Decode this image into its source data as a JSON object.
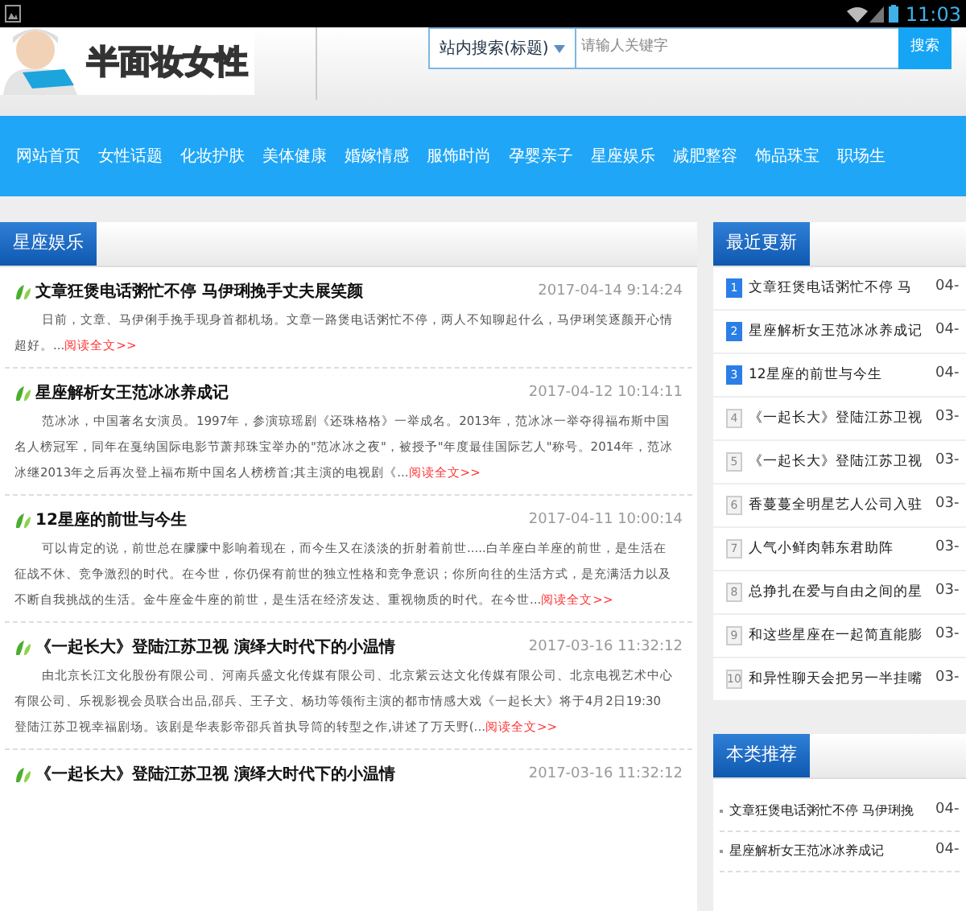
{
  "status_bar": {
    "time": "11:03"
  },
  "header": {
    "logo_text": "半面妆女性",
    "search": {
      "scope": "站内搜索(标题)",
      "placeholder": "请输人关键字",
      "button": "搜索"
    }
  },
  "nav": [
    "网站首页",
    "女性话题",
    "化妆护肤",
    "美体健康",
    "婚嫁情感",
    "服饰时尚",
    "孕婴亲子",
    "星座娱乐",
    "减肥整容",
    "饰品珠宝",
    "职场生"
  ],
  "main": {
    "tab": "星座娱乐",
    "articles": [
      {
        "title": "文章狂煲电话粥忙不停 马伊琍挽手丈夫展笑颜",
        "date": "2017-04-14 9:14:24",
        "summary": "日前，文章、马伊俐手挽手现身首都机场。文章一路煲电话粥忙不停，两人不知聊起什么，马伊琍笑逐颜开心情超好。...",
        "more": "阅读全文>>"
      },
      {
        "title": "星座解析女王范冰冰养成记",
        "date": "2017-04-12 10:14:11",
        "summary": "范冰冰，中国著名女演员。1997年，参演琼瑶剧《还珠格格》一举成名。2013年，范冰冰一举夺得福布斯中国名人榜冠军，同年在戛纳国际电影节萧邦珠宝举办的\"范冰冰之夜\"，被授予\"年度最佳国际艺人\"称号。2014年，范冰冰继2013年之后再次登上福布斯中国名人榜榜首;其主演的电视剧《...",
        "more": "阅读全文>>"
      },
      {
        "title": "12星座的前世与今生",
        "date": "2017-04-11 10:00:14",
        "summary": "可以肯定的说，前世总在朦朦中影响着现在，而今生又在淡淡的折射着前世.....白羊座白羊座的前世，是生活在征战不休、竞争激烈的时代。在今世，你仍保有前世的独立性格和竞争意识；你所向往的生活方式，是充满活力以及不断自我挑战的生活。金牛座金牛座的前世，是生活在经济发达、重视物质的时代。在今世...",
        "more": "阅读全文>>"
      },
      {
        "title": "《一起长大》登陆江苏卫视 演绎大时代下的小温情",
        "date": "2017-03-16 11:32:12",
        "summary": "由北京长江文化股份有限公司、河南兵盛文化传媒有限公司、北京紫云达文化传媒有限公司、北京电视艺术中心有限公司、乐视影视会员联合出品,邵兵、王子文、杨玏等领衔主演的都市情感大戏《一起长大》将于4月2日19:30登陆江苏卫视幸福剧场。该剧是华表影帝邵兵首执导筒的转型之作,讲述了万天野(...",
        "more": "阅读全文>>"
      },
      {
        "title": "《一起长大》登陆江苏卫视 演绎大时代下的小温情",
        "date": "2017-03-16 11:32:12"
      }
    ]
  },
  "recent": {
    "title": "最近更新",
    "items": [
      {
        "rank": "1",
        "title": "文章狂煲电话粥忙不停 马",
        "date": "04-",
        "highlighted": true
      },
      {
        "rank": "2",
        "title": "星座解析女王范冰冰养成记",
        "date": "04-",
        "highlighted": true
      },
      {
        "rank": "3",
        "title": "12星座的前世与今生",
        "date": "04-",
        "highlighted": true
      },
      {
        "rank": "4",
        "title": "《一起长大》登陆江苏卫视",
        "date": "03-",
        "highlighted": false
      },
      {
        "rank": "5",
        "title": "《一起长大》登陆江苏卫视",
        "date": "03-",
        "highlighted": false
      },
      {
        "rank": "6",
        "title": "香蔓蔓全明星艺人公司入驻",
        "date": "03-",
        "highlighted": false
      },
      {
        "rank": "7",
        "title": "人气小鲜肉韩东君助阵",
        "date": "03-",
        "highlighted": false
      },
      {
        "rank": "8",
        "title": "总挣扎在爱与自由之间的星",
        "date": "03-",
        "highlighted": false
      },
      {
        "rank": "9",
        "title": "和这些星座在一起简直能膨",
        "date": "03-",
        "highlighted": false
      },
      {
        "rank": "10",
        "title": "和异性聊天会把另一半挂嘴",
        "date": "03-",
        "highlighted": false
      }
    ]
  },
  "recommended": {
    "title": "本类推荐",
    "items": [
      {
        "title": "文章狂煲电话粥忙不停 马伊琍挽",
        "date": "04-"
      },
      {
        "title": "星座解析女王范冰冰养成记",
        "date": "04-"
      }
    ]
  }
}
